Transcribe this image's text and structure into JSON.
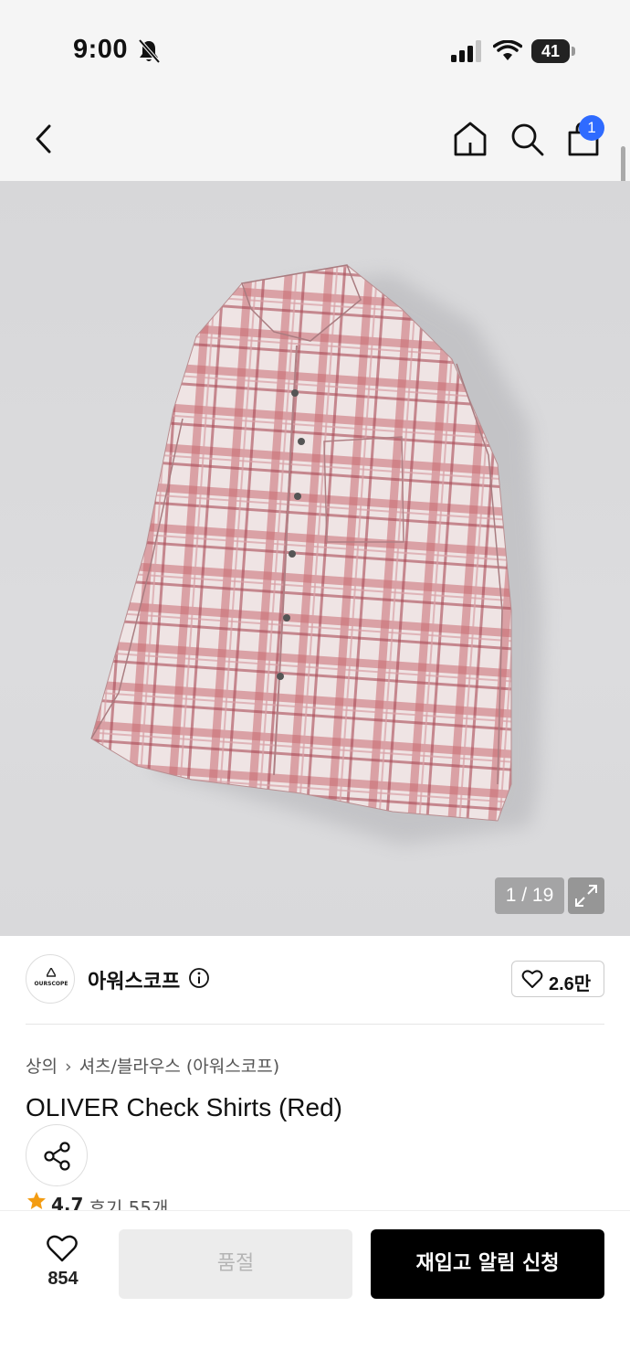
{
  "status_bar": {
    "time": "9:00",
    "battery": "41",
    "icons": [
      "bell-off-icon",
      "signal-icon",
      "wifi-icon",
      "battery-icon"
    ]
  },
  "nav": {
    "icons": [
      "back-arrow-icon",
      "home-icon",
      "search-icon",
      "shopping-bag-icon"
    ],
    "cart_badge": "1"
  },
  "gallery": {
    "pager": "1 / 19",
    "expand_icon": "expand-icon"
  },
  "brand": {
    "logo_text": "OURSCOPE",
    "name": "아워스코프",
    "like_count": "2.6만"
  },
  "product": {
    "breadcrumb": [
      "상의",
      "셔츠/블라우스 (아워스코프)"
    ],
    "title": "OLIVER Check Shirts (Red)",
    "rating": "4.7",
    "reviews": "후기 55개"
  },
  "bottom_bar": {
    "wish_count": "854",
    "soldout_label": "품절",
    "restock_label": "재입고 알림 신청"
  },
  "colors": {
    "accent_badge": "#2f6bff",
    "primary_button": "#000000",
    "star": "#f39c12",
    "disabled_button": "#ececec"
  }
}
